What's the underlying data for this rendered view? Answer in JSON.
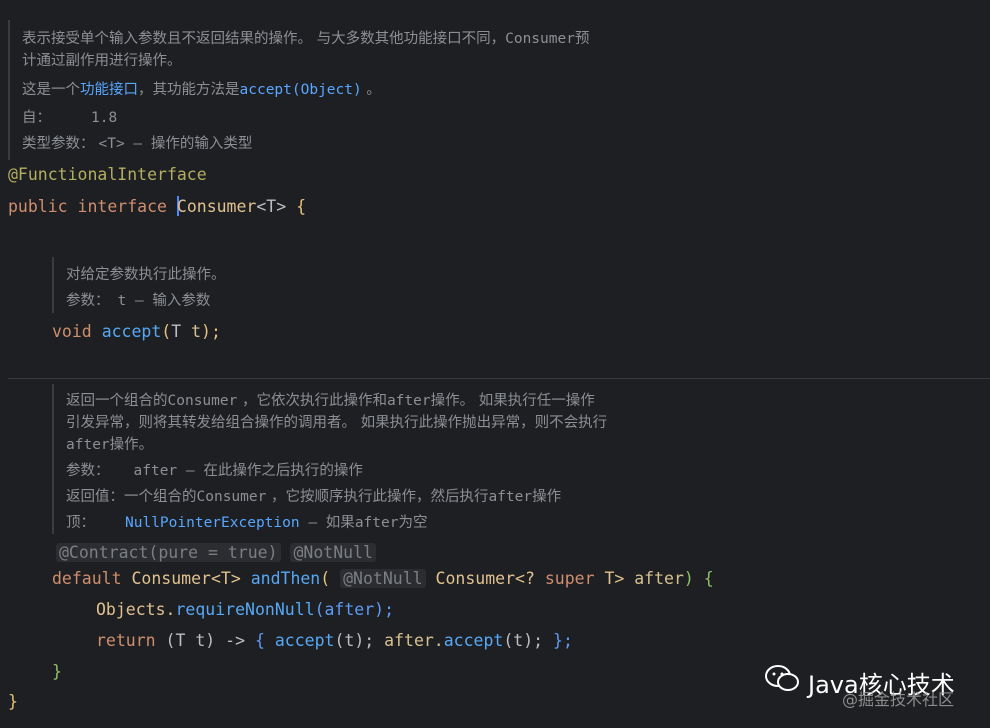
{
  "doc_class": {
    "line1_prefix": "表示接受单个输入参数且不返回结果的操作。 与大多数其他功能接口不同，",
    "line1_code": "Consumer",
    "line1_suffix": "预",
    "line2": "计通过副作用进行操作。",
    "line3_prefix": "这是一个",
    "line3_link": "功能接口",
    "line3_mid": "，其功能方法是",
    "line3_code": "accept(Object)",
    "line3_suffix": " 。",
    "since_label": "自：",
    "since_value": "1.8",
    "type_params_label": "类型参数：",
    "type_params_value": "<T> – 操作的输入类型"
  },
  "code": {
    "annotation": "@FunctionalInterface",
    "kw_public": "public",
    "kw_interface": "interface",
    "class_name": "Consumer",
    "type_param": "<T>",
    "brace_open": "{",
    "void_kw": "void",
    "accept_fn": "accept",
    "accept_params_open": "(",
    "accept_T": "T",
    "accept_t": "t",
    "accept_close": ");",
    "contract_hint": "@Contract(pure = true)",
    "notnull_hint": "@NotNull",
    "default_kw": "default",
    "consumer_ret": "Consumer<T>",
    "andthen_fn": "andThen",
    "paren_open": "(",
    "param_notnull": "@NotNull",
    "param_type_a": "Consumer<?",
    "param_super": "super",
    "param_type_b": "T>",
    "param_name": "after",
    "paren_close_brace": ") {",
    "objects": "Objects.",
    "require_fn": "requireNonNull",
    "require_args": "(after);",
    "return_kw": "return",
    "lambda_a": "(T t) ->",
    "lambda_brace_open": "{",
    "lambda_accept": "accept",
    "lambda_accept_args": "(t);",
    "lambda_after": "after.",
    "lambda_after_accept": "accept",
    "lambda_after_args": "(t);",
    "lambda_brace_close": "};",
    "method_close": "}",
    "class_close": "}"
  },
  "doc_accept": {
    "line1": "对给定参数执行此操作。",
    "params_label": "参数：",
    "params_value": "t – 输入参数"
  },
  "doc_andthen": {
    "line1_a": "返回一个组合的",
    "line1_code": "Consumer",
    "line1_b": " ，它依次执行此操作和",
    "line1_code2": "after",
    "line1_c": "操作。 如果执行任一操作",
    "line2": "引发异常，则将其转发给组合操作的调用者。 如果执行此操作抛出异常，则不会执行",
    "line3_code": "after",
    "line3": "操作。",
    "params_label": "参数：",
    "params_value_code": "after",
    "params_value": " – 在此操作之后执行的操作",
    "returns_label": "返回值：",
    "returns_a": "一个组合的",
    "returns_code": "Consumer",
    "returns_b": " ，它按顺序执行此操作，然后执行",
    "returns_code2": "after",
    "returns_c": "操作",
    "throws_label": "顶：",
    "throws_link": "NullPointerException",
    "throws_value_a": " – 如果",
    "throws_code": "after",
    "throws_value_b": "为空"
  },
  "watermark": {
    "main": "Java核心技术",
    "sub": "@掘金技术社区"
  }
}
